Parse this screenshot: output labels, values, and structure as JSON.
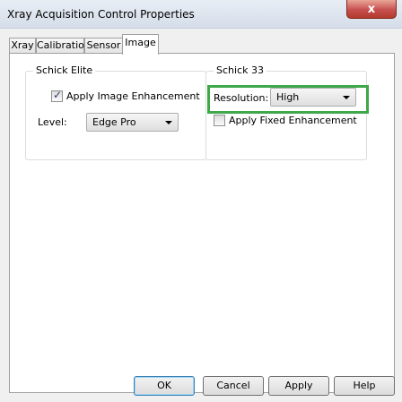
{
  "window": {
    "title": "Xray Acquisition Control Properties",
    "close_label": "x"
  },
  "tabs": [
    {
      "label": "Xray",
      "selected": false
    },
    {
      "label": "Calibration",
      "selected": false
    },
    {
      "label": "Sensor",
      "selected": false
    },
    {
      "label": "Image",
      "selected": true
    }
  ],
  "schick_elite": {
    "title": "Schick Elite",
    "apply_enhancement": {
      "label": "Apply Image Enhancement",
      "checked": true
    },
    "level": {
      "label": "Level:",
      "value": "Edge Pro"
    }
  },
  "schick_33": {
    "title": "Schick 33",
    "resolution": {
      "label": "Resolution:",
      "value": "High"
    },
    "apply_fixed": {
      "label": "Apply Fixed Enhancement",
      "checked": false
    }
  },
  "buttons": {
    "ok": "OK",
    "cancel": "Cancel",
    "apply": "Apply",
    "help": "Help"
  },
  "colors": {
    "highlight": "#3ea84a",
    "close": "#c75050"
  }
}
